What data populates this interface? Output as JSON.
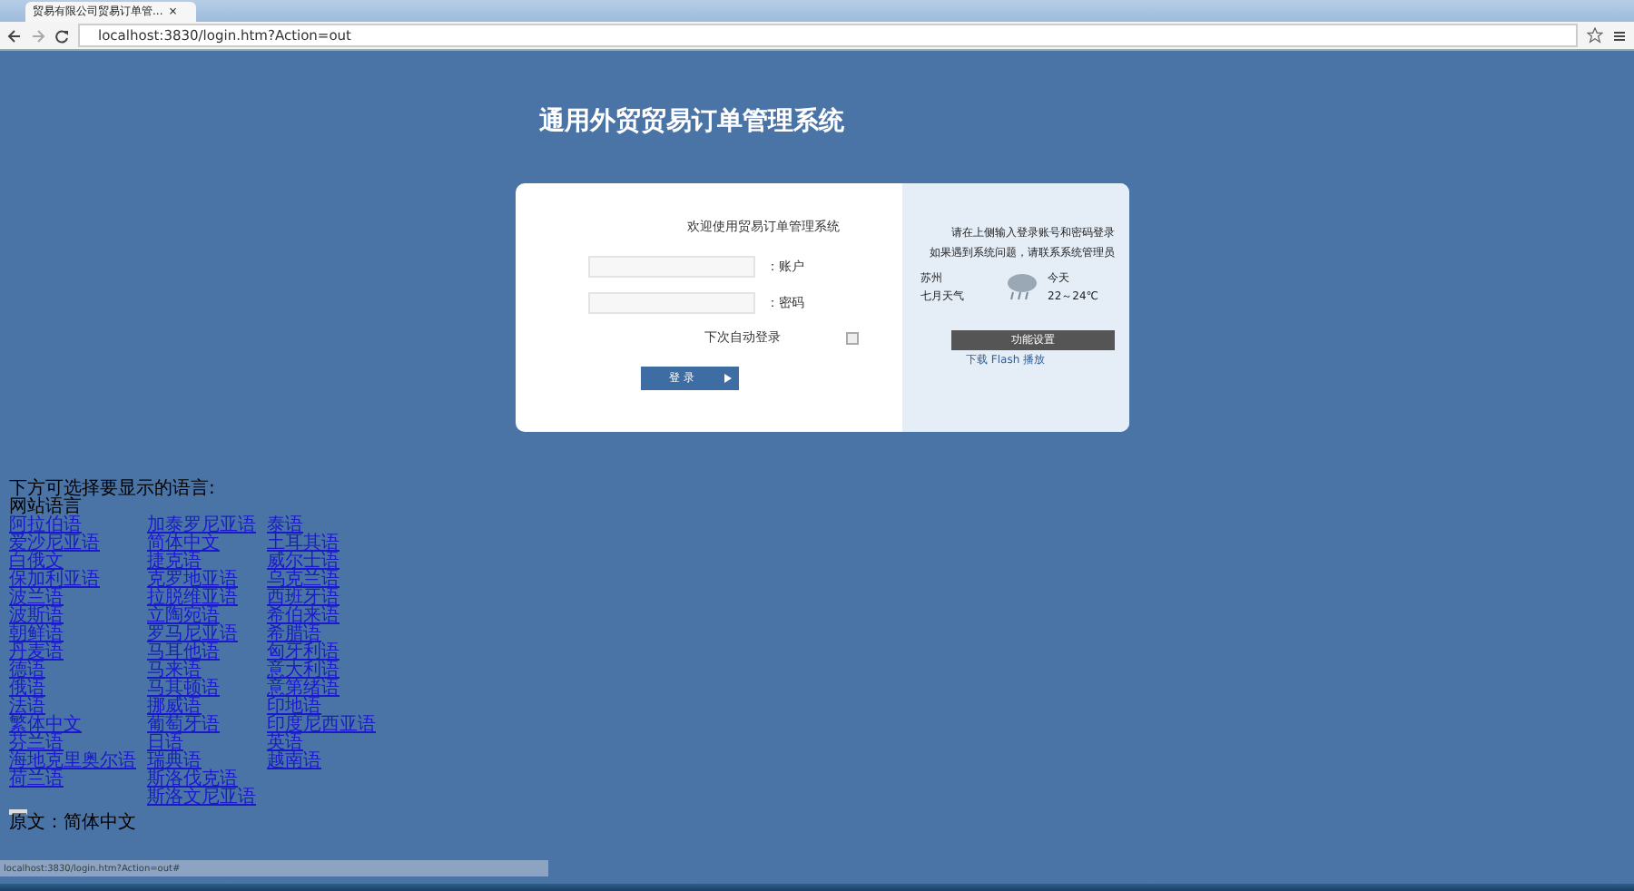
{
  "browser": {
    "tab_title": "贸易有限公司贸易订单管...",
    "tab_close": "×",
    "url": "localhost:3830/login.htm?Action=out"
  },
  "page_title": "通用外贸贸易订单管理系统",
  "login": {
    "heading": "欢迎使用贸易订单管理系统",
    "fields": [
      {
        "label": "：账户"
      },
      {
        "label": "：密码"
      }
    ],
    "remember": {
      "label": "下次自动登录",
      "checked": false
    },
    "submit": "登 录"
  },
  "info": {
    "lines": [
      "请在上侧输入登录账号和密码登录",
      "如果遇到系统问题，请联系系统管理员"
    ],
    "weather": {
      "city": "苏州",
      "month": "七月天气",
      "day": "今天",
      "temp": "22～24℃"
    },
    "settings_button": "功能设置",
    "link": "下载 Flash 播放"
  },
  "languages": {
    "intro": "下方可选择要显示的语言:",
    "heading": "网站语言",
    "columns": [
      [
        "阿拉伯语",
        "爱沙尼亚语",
        "白俄文",
        "保加利亚语",
        "波兰语",
        "波斯语",
        "朝鲜语",
        "丹麦语",
        "德语",
        "俄语",
        "法语",
        "繁体中文",
        "芬兰语",
        "海地克里奥尔语",
        "荷兰语"
      ],
      [
        "加泰罗尼亚语",
        "简体中文",
        "捷克语",
        "克罗地亚语",
        "拉脱维亚语",
        "立陶宛语",
        "罗马尼亚语",
        "马耳他语",
        "马来语",
        "马其顿语",
        "挪威语",
        "葡萄牙语",
        "日语",
        "瑞典语",
        "斯洛伐克语",
        "斯洛文尼亚语"
      ],
      [
        "泰语",
        "土耳其语",
        "威尔士语",
        "乌克兰语",
        "西班牙语",
        "希伯来语",
        "希腊语",
        "匈牙利语",
        "意大利语",
        "意第绪语",
        "印地语",
        "印度尼西亚语",
        "英语",
        "越南语"
      ]
    ],
    "original": "原文：简体中文"
  },
  "status_bar": "localhost:3830/login.htm?Action=out#"
}
